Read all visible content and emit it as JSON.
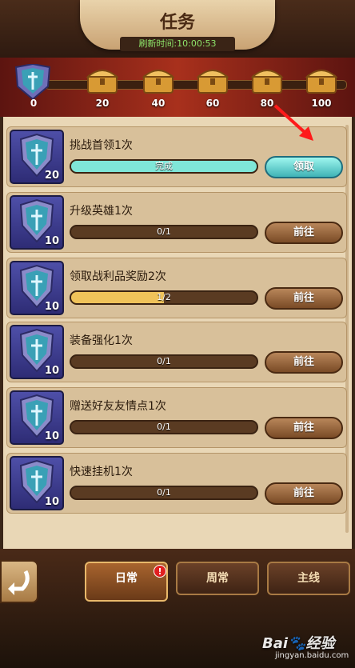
{
  "header": {
    "title": "任务",
    "refresh_label": "刷新时间:10:00:53"
  },
  "milestones": {
    "current": "0",
    "chests": [
      "20",
      "40",
      "60",
      "80",
      "100"
    ]
  },
  "tasks": [
    {
      "name": "挑战首领1次",
      "points": "20",
      "progress": "完成",
      "fill": 1.0,
      "button": "领取",
      "state": "claim"
    },
    {
      "name": "升级英雄1次",
      "points": "10",
      "progress": "0/1",
      "fill": 0.0,
      "button": "前往",
      "state": "goto"
    },
    {
      "name": "领取战利品奖励2次",
      "points": "10",
      "progress": "1/2",
      "fill": 0.5,
      "button": "前往",
      "state": "goto"
    },
    {
      "name": "装备强化1次",
      "points": "10",
      "progress": "0/1",
      "fill": 0.0,
      "button": "前往",
      "state": "goto"
    },
    {
      "name": "赠送好友友情点1次",
      "points": "10",
      "progress": "0/1",
      "fill": 0.0,
      "button": "前往",
      "state": "goto"
    },
    {
      "name": "快速挂机1次",
      "points": "10",
      "progress": "0/1",
      "fill": 0.0,
      "button": "前往",
      "state": "goto"
    }
  ],
  "tabs": {
    "daily": "日常",
    "weekly": "周常",
    "main": "主线",
    "badge": "!"
  },
  "watermark": {
    "brand": "Bai🐾经验",
    "url": "jingyan.baidu.com"
  },
  "colors": {
    "claim": "#3fb3b6",
    "goto": "#7a4b26",
    "complete_fill": "#7fe6d8",
    "partial_fill": "#f0c35a"
  }
}
